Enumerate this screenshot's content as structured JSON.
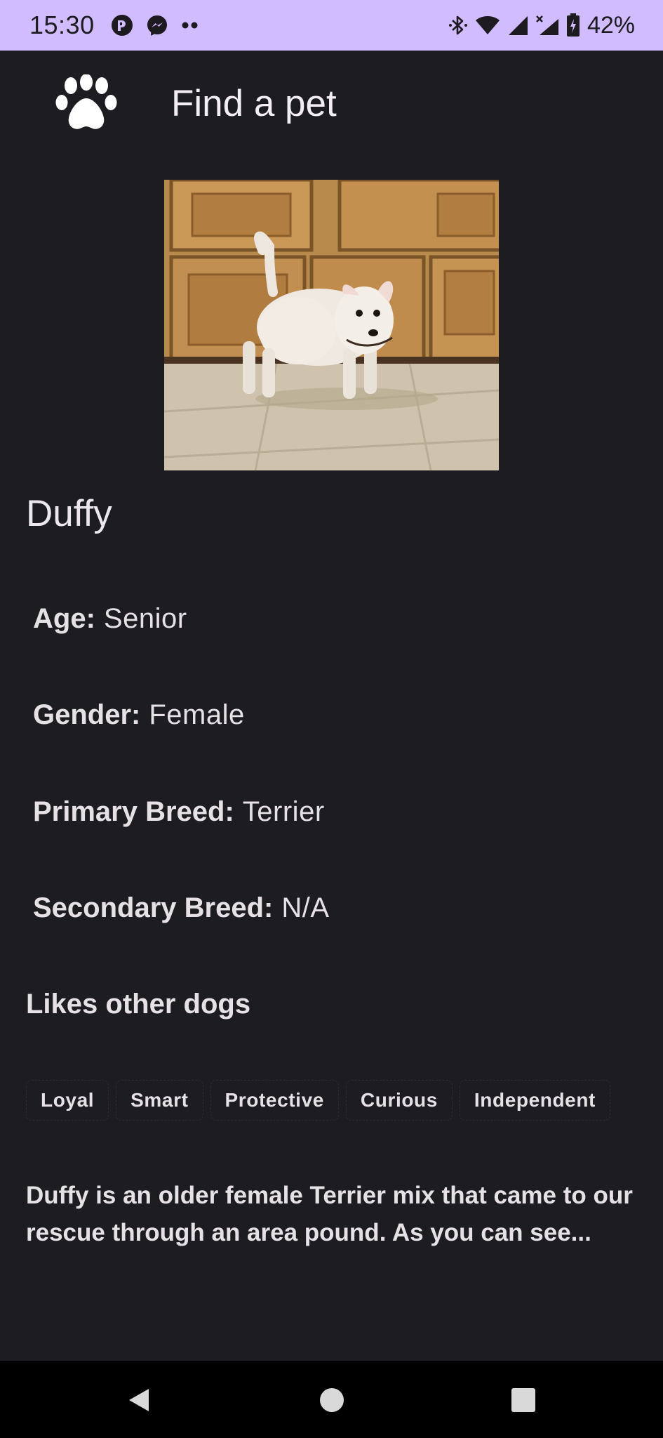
{
  "status_bar": {
    "time": "15:30",
    "battery_percent": "42%",
    "icons": [
      "app-notification-icon",
      "messenger-icon",
      "more-dots-icon",
      "bluetooth-icon",
      "wifi-icon",
      "signal-icon",
      "signal-no-data-icon",
      "battery-icon"
    ],
    "background_color": "#d0bcff"
  },
  "app_bar": {
    "logo_icon": "paw-icon",
    "title": "Find a pet"
  },
  "pet": {
    "name": "Duffy",
    "details": [
      {
        "label": "Age:",
        "value": "Senior"
      },
      {
        "label": "Gender:",
        "value": "Female"
      },
      {
        "label": "Primary Breed:",
        "value": "Terrier"
      },
      {
        "label": "Secondary Breed:",
        "value": "N/A"
      }
    ],
    "likes": "Likes other dogs",
    "tags": [
      "Loyal",
      "Smart",
      "Protective",
      "Curious",
      "Independent"
    ],
    "description": "Duffy is an older female Terrier mix that came to our rescue through an area pound. As you can see..."
  },
  "nav_bar": {
    "buttons": [
      "back-icon",
      "home-icon",
      "recents-icon"
    ]
  },
  "colors": {
    "background": "#1d1c21",
    "text": "#e6e1e5",
    "accent": "#d0bcff"
  }
}
